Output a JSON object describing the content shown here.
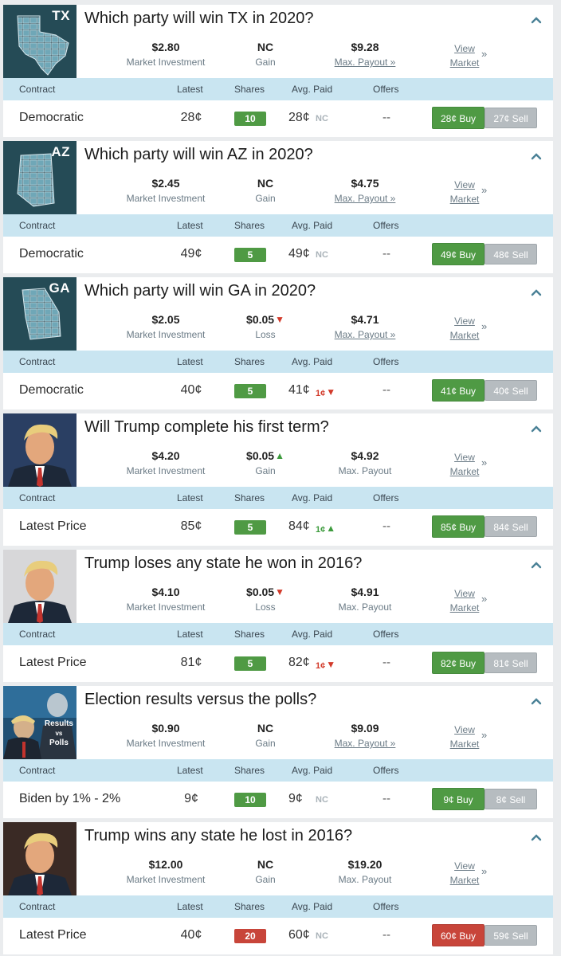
{
  "colors": {
    "accent_green": "#4f9a44",
    "accent_red": "#c8453a",
    "header_blue": "#c9e5f1",
    "muted_text": "#6b7b86",
    "sell_grey": "#b6bcc0",
    "thumb_map_bg": "#254b56"
  },
  "columns": {
    "contract": "Contract",
    "latest": "Latest",
    "shares": "Shares",
    "avg_paid": "Avg. Paid",
    "offers": "Offers"
  },
  "labels": {
    "market_investment": "Market Investment",
    "view": "View",
    "market": "Market",
    "view_chevron": "»",
    "collapse_icon": "chevron-up-icon"
  },
  "markets": [
    {
      "title": "Which party will win TX in 2020?",
      "thumb_kind": "map",
      "thumb_abbr": "TX",
      "investment": "$2.80",
      "gain_value": "NC",
      "gain_dir": "",
      "gain_label": "Gain",
      "payout_value": "$9.28",
      "payout_label": "Max. Payout »",
      "payout_link": true,
      "contract": "Democratic",
      "latest": "28¢",
      "shares": "10",
      "shares_color": "green",
      "avg_paid": "28¢",
      "avg_delta": "NC",
      "avg_delta_dir": "",
      "offers": "--",
      "buy": "28¢ Buy",
      "buy_color": "green",
      "sell": "27¢ Sell"
    },
    {
      "title": "Which party will win AZ in 2020?",
      "thumb_kind": "map",
      "thumb_abbr": "AZ",
      "investment": "$2.45",
      "gain_value": "NC",
      "gain_dir": "",
      "gain_label": "Gain",
      "payout_value": "$4.75",
      "payout_label": "Max. Payout »",
      "payout_link": true,
      "contract": "Democratic",
      "latest": "49¢",
      "shares": "5",
      "shares_color": "green",
      "avg_paid": "49¢",
      "avg_delta": "NC",
      "avg_delta_dir": "",
      "offers": "--",
      "buy": "49¢ Buy",
      "buy_color": "green",
      "sell": "48¢ Sell"
    },
    {
      "title": "Which party will win GA in 2020?",
      "thumb_kind": "map",
      "thumb_abbr": "GA",
      "investment": "$2.05",
      "gain_value": "$0.05",
      "gain_dir": "down",
      "gain_label": "Loss",
      "payout_value": "$4.71",
      "payout_label": "Max. Payout »",
      "payout_link": true,
      "contract": "Democratic",
      "latest": "40¢",
      "shares": "5",
      "shares_color": "green",
      "avg_paid": "41¢",
      "avg_delta": "1¢",
      "avg_delta_dir": "down",
      "offers": "--",
      "buy": "41¢ Buy",
      "buy_color": "green",
      "sell": "40¢ Sell"
    },
    {
      "title": "Will Trump complete his first term?",
      "thumb_kind": "photo",
      "thumb_abbr": "",
      "investment": "$4.20",
      "gain_value": "$0.05",
      "gain_dir": "up",
      "gain_label": "Gain",
      "payout_value": "$4.92",
      "payout_label": "Max. Payout",
      "payout_link": false,
      "contract": "Latest Price",
      "latest": "85¢",
      "shares": "5",
      "shares_color": "green",
      "avg_paid": "84¢",
      "avg_delta": "1¢",
      "avg_delta_dir": "up",
      "offers": "--",
      "buy": "85¢ Buy",
      "buy_color": "green",
      "sell": "84¢ Sell"
    },
    {
      "title": "Trump loses any state he won in 2016?",
      "thumb_kind": "photo",
      "thumb_abbr": "",
      "investment": "$4.10",
      "gain_value": "$0.05",
      "gain_dir": "down",
      "gain_label": "Loss",
      "payout_value": "$4.91",
      "payout_label": "Max. Payout",
      "payout_link": false,
      "contract": "Latest Price",
      "latest": "81¢",
      "shares": "5",
      "shares_color": "green",
      "avg_paid": "82¢",
      "avg_delta": "1¢",
      "avg_delta_dir": "down",
      "offers": "--",
      "buy": "82¢ Buy",
      "buy_color": "green",
      "sell": "81¢ Sell"
    },
    {
      "title": "Election results versus the polls?",
      "thumb_kind": "polls",
      "thumb_abbr": "",
      "thumb_text": [
        "Results",
        "vs",
        "Polls"
      ],
      "investment": "$0.90",
      "gain_value": "NC",
      "gain_dir": "",
      "gain_label": "Gain",
      "payout_value": "$9.09",
      "payout_label": "Max. Payout »",
      "payout_link": true,
      "contract": "Biden by 1% - 2%",
      "latest": "9¢",
      "shares": "10",
      "shares_color": "green",
      "avg_paid": "9¢",
      "avg_delta": "NC",
      "avg_delta_dir": "",
      "offers": "--",
      "buy": "9¢ Buy",
      "buy_color": "green",
      "sell": "8¢ Sell"
    },
    {
      "title": "Trump wins any state he lost in 2016?",
      "thumb_kind": "photo",
      "thumb_abbr": "",
      "investment": "$12.00",
      "gain_value": "NC",
      "gain_dir": "",
      "gain_label": "Gain",
      "payout_value": "$19.20",
      "payout_label": "Max. Payout",
      "payout_link": false,
      "contract": "Latest Price",
      "latest": "40¢",
      "shares": "20",
      "shares_color": "red",
      "avg_paid": "60¢",
      "avg_delta": "NC",
      "avg_delta_dir": "",
      "offers": "--",
      "buy": "60¢ Buy",
      "buy_color": "red",
      "sell": "59¢ Sell"
    }
  ]
}
